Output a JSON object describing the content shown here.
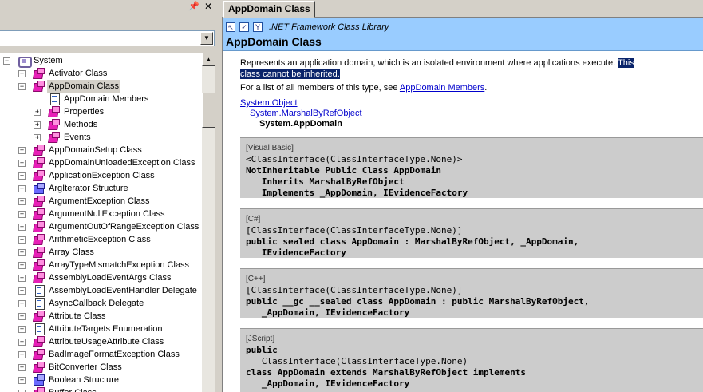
{
  "left_pane": {
    "pin_glyph": "📌",
    "close_glyph": "✕",
    "filter_value": "",
    "tree": [
      {
        "label": "System",
        "icon": "namespace-icon",
        "depth": 0,
        "expander": "−"
      },
      {
        "label": "Activator Class",
        "icon": "class-icon",
        "depth": 1,
        "expander": "+"
      },
      {
        "label": "AppDomain Class",
        "icon": "class-icon",
        "depth": 1,
        "expander": "−",
        "selected": true
      },
      {
        "label": "AppDomain Members",
        "icon": "page-icon",
        "depth": 2,
        "expander": ""
      },
      {
        "label": "Properties",
        "icon": "class-icon",
        "depth": 2,
        "expander": "+"
      },
      {
        "label": "Methods",
        "icon": "class-icon",
        "depth": 2,
        "expander": "+"
      },
      {
        "label": "Events",
        "icon": "class-icon",
        "depth": 2,
        "expander": "+"
      },
      {
        "label": "AppDomainSetup Class",
        "icon": "class-icon",
        "depth": 1,
        "expander": "+"
      },
      {
        "label": "AppDomainUnloadedException Class",
        "icon": "class-icon",
        "depth": 1,
        "expander": "+"
      },
      {
        "label": "ApplicationException Class",
        "icon": "class-icon",
        "depth": 1,
        "expander": "+"
      },
      {
        "label": "ArgIterator Structure",
        "icon": "struct-icon",
        "depth": 1,
        "expander": "+"
      },
      {
        "label": "ArgumentException Class",
        "icon": "class-icon",
        "depth": 1,
        "expander": "+"
      },
      {
        "label": "ArgumentNullException Class",
        "icon": "class-icon",
        "depth": 1,
        "expander": "+"
      },
      {
        "label": "ArgumentOutOfRangeException Class",
        "icon": "class-icon",
        "depth": 1,
        "expander": "+"
      },
      {
        "label": "ArithmeticException Class",
        "icon": "class-icon",
        "depth": 1,
        "expander": "+"
      },
      {
        "label": "Array Class",
        "icon": "class-icon",
        "depth": 1,
        "expander": "+"
      },
      {
        "label": "ArrayTypeMismatchException Class",
        "icon": "class-icon",
        "depth": 1,
        "expander": "+"
      },
      {
        "label": "AssemblyLoadEventArgs Class",
        "icon": "class-icon",
        "depth": 1,
        "expander": "+"
      },
      {
        "label": "AssemblyLoadEventHandler Delegate",
        "icon": "page-icon",
        "depth": 1,
        "expander": "+"
      },
      {
        "label": "AsyncCallback Delegate",
        "icon": "page-icon",
        "depth": 1,
        "expander": "+"
      },
      {
        "label": "Attribute Class",
        "icon": "class-icon",
        "depth": 1,
        "expander": "+"
      },
      {
        "label": "AttributeTargets Enumeration",
        "icon": "page-icon",
        "depth": 1,
        "expander": "+"
      },
      {
        "label": "AttributeUsageAttribute Class",
        "icon": "class-icon",
        "depth": 1,
        "expander": "+"
      },
      {
        "label": "BadImageFormatException Class",
        "icon": "class-icon",
        "depth": 1,
        "expander": "+"
      },
      {
        "label": "BitConverter Class",
        "icon": "class-icon",
        "depth": 1,
        "expander": "+"
      },
      {
        "label": "Boolean Structure",
        "icon": "struct-icon",
        "depth": 1,
        "expander": "+"
      },
      {
        "label": "Buffer Class",
        "icon": "class-icon",
        "depth": 1,
        "expander": "+"
      }
    ]
  },
  "right_pane": {
    "tab_label": "AppDomain Class",
    "banner": {
      "library": ".NET Framework Class Library",
      "title": "AppDomain Class"
    },
    "description_plain": "Represents an application domain, which is an isolated environment where applications execute.",
    "description_selected_1": "This",
    "description_selected_2": "class cannot be inherited.",
    "members_prefix": "For a list of all members of this type, see ",
    "members_link": "AppDomain Members",
    "members_suffix": ".",
    "hierarchy": {
      "level1": "System.Object",
      "level2": "System.MarshalByRefObject",
      "level3": "System.AppDomain"
    },
    "syntax": {
      "vb": {
        "lang": "[Visual Basic]",
        "line1": "<ClassInterface(ClassInterfaceType.None)>",
        "line2": "NotInheritable Public Class AppDomain",
        "line3": "   Inherits MarshalByRefObject",
        "line4": "   Implements _AppDomain, IEvidenceFactory"
      },
      "cs": {
        "lang": "[C#]",
        "line1": "[ClassInterface(ClassInterfaceType.None)]",
        "line2": "public sealed class AppDomain : MarshalByRefObject, _AppDomain,",
        "line3": "   IEvidenceFactory"
      },
      "cpp": {
        "lang": "[C++]",
        "line1": "[ClassInterface(ClassInterfaceType.None)]",
        "line2": "public __gc __sealed class AppDomain : public MarshalByRefObject,",
        "line3": "   _AppDomain, IEvidenceFactory"
      },
      "js": {
        "lang": "[JScript]",
        "line1": "public",
        "line2": "   ClassInterface(ClassInterfaceType.None)",
        "line3": "class AppDomain extends MarshalByRefObject implements",
        "line4": "   _AppDomain, IEvidenceFactory"
      }
    }
  }
}
